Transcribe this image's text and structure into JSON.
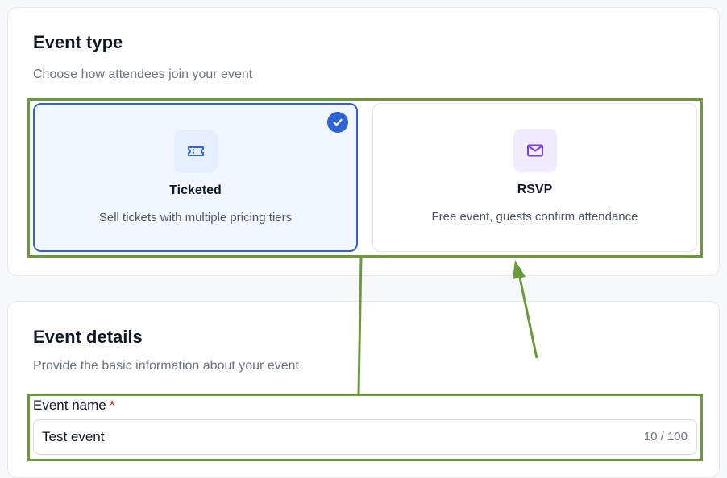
{
  "event_type": {
    "title": "Event type",
    "subtitle": "Choose how attendees join your event",
    "options": [
      {
        "label": "Ticketed",
        "description": "Sell tickets with multiple pricing tiers",
        "icon": "ticket-icon",
        "selected": true
      },
      {
        "label": "RSVP",
        "description": "Free event, guests confirm attendance",
        "icon": "envelope-icon",
        "selected": false
      }
    ]
  },
  "event_details": {
    "title": "Event details",
    "subtitle": "Provide the basic information about your event",
    "name_field": {
      "label": "Event name",
      "required_mark": "*",
      "value": "Test event",
      "counter": "10 / 100"
    }
  },
  "colors": {
    "accent": "#2f64d8",
    "selected_bg": "#f1f6ff",
    "purple_icon": "#7c3aed",
    "annotation": "#6a9a3a",
    "required": "#dc2626"
  }
}
